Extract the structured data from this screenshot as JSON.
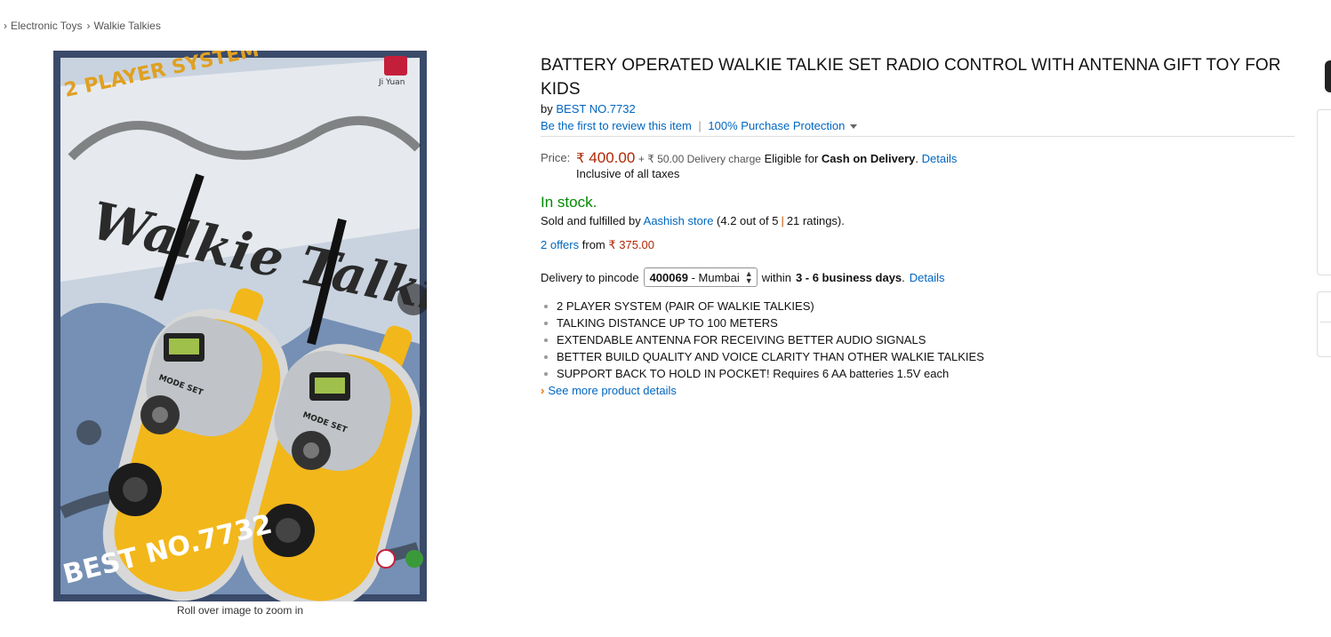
{
  "breadcrumb": [
    "Electronic Toys",
    "Walkie Talkies"
  ],
  "image": {
    "brand_text_1": "2 PLAYER SYSTEM",
    "brand_text_2": "Walkie Talkie",
    "brand_text_3": "BEST NO.7732",
    "brand_text_4": "Ji Yuan",
    "zoom_hint": "Roll over image to zoom in"
  },
  "product": {
    "title": "BATTERY OPERATED WALKIE TALKIE SET RADIO CONTROL WITH ANTENNA GIFT TOY FOR KIDS",
    "by_prefix": "by",
    "brand": "BEST NO.7732",
    "review_link": "Be the first to review this item",
    "protection_link": "100% Purchase Protection"
  },
  "price": {
    "label": "Price:",
    "currency": "₹",
    "amount": "400.00",
    "plus": "+",
    "delivery_charge": "₹ 50.00 Delivery charge",
    "eligible_prefix": "Eligible for",
    "cod": "Cash on Delivery",
    "period": ".",
    "details_link": "Details",
    "inclusive": "Inclusive of all taxes"
  },
  "stock": {
    "status": "In stock.",
    "sold_prefix": "Sold and fulfilled by",
    "seller": "Aashish store",
    "rating_open": "(4.2 out of 5",
    "rating_count": "21 ratings",
    "rating_close": ")."
  },
  "offers": {
    "link": "2 offers",
    "from": "from",
    "price": "₹ 375.00"
  },
  "delivery": {
    "prefix": "Delivery to pincode",
    "pincode": "400069",
    "city": "- Mumbai",
    "within": "within",
    "days": "3 - 6 business days",
    "period": ".",
    "details_link": "Details"
  },
  "bullets": [
    "2 PLAYER SYSTEM (PAIR OF WALKIE TALKIES)",
    "TALKING DISTANCE UP TO 100 METERS",
    "EXTENDABLE ANTENNA FOR RECEIVING BETTER AUDIO SIGNALS",
    "BETTER BUILD QUALITY AND VOICE CLARITY THAN OTHER WALKIE TALKIES",
    "SUPPORT BACK TO HOLD IN POCKET! Requires 6 AA batteries 1.5V each"
  ],
  "see_more": "See more product details",
  "colors": {
    "link": "#0066c0",
    "price": "#b12704",
    "in_stock": "#008a00",
    "toy_yellow": "#f2b71a"
  }
}
